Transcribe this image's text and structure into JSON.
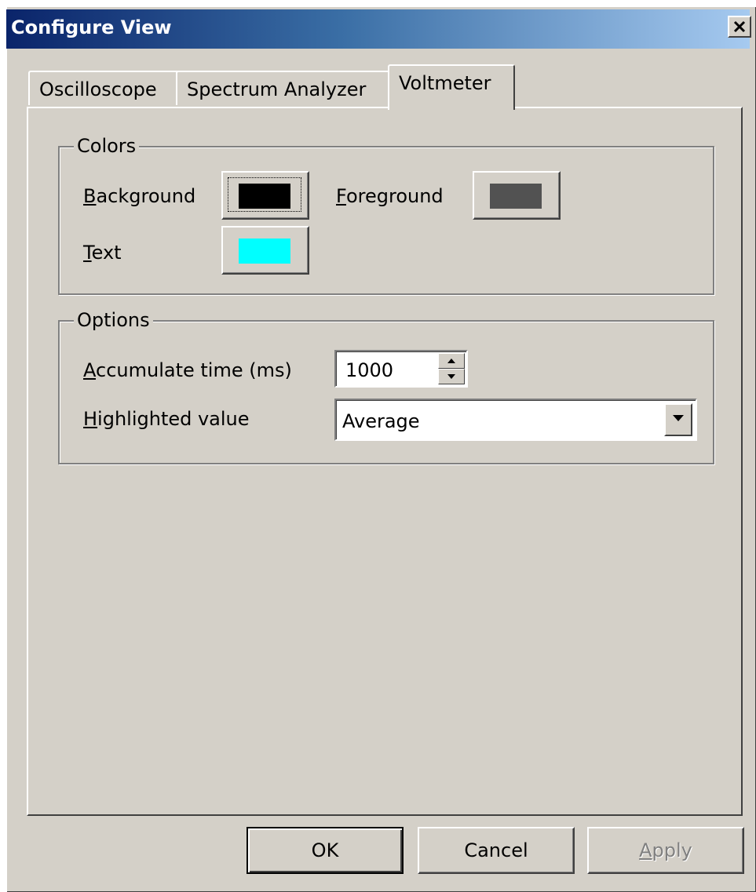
{
  "window": {
    "title": "Configure View",
    "close_icon": "close-icon"
  },
  "tabs": [
    {
      "label": "Oscilloscope",
      "active": false
    },
    {
      "label": "Spectrum Analyzer",
      "active": false
    },
    {
      "label": "Voltmeter",
      "active": true
    }
  ],
  "colors_group": {
    "legend": "Colors",
    "background": {
      "label_mnemonic": "B",
      "label_rest": "ackground",
      "color": "#000000"
    },
    "foreground": {
      "label_mnemonic": "F",
      "label_rest": "oreground",
      "color": "#525252"
    },
    "text": {
      "label_mnemonic": "T",
      "label_rest": "ext",
      "color": "#00ffff"
    }
  },
  "options_group": {
    "legend": "Options",
    "accumulate": {
      "label_mnemonic": "A",
      "label_rest": "ccumulate time (ms)",
      "value": "1000"
    },
    "highlighted": {
      "label_mnemonic": "H",
      "label_rest": "ighlighted value",
      "value": "Average"
    }
  },
  "buttons": {
    "ok": "OK",
    "cancel": "Cancel",
    "apply_mnemonic": "A",
    "apply_rest": "pply"
  }
}
